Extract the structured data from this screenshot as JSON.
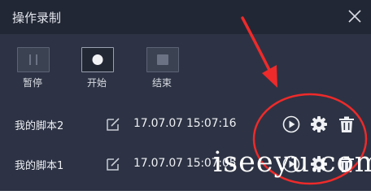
{
  "window": {
    "title": "操作录制",
    "close_icon": "close-icon"
  },
  "controls": [
    {
      "label": "暂停",
      "icon": "pause-icon"
    },
    {
      "label": "开始",
      "icon": "record-icon"
    },
    {
      "label": "结束",
      "icon": "stop-icon"
    }
  ],
  "scripts": [
    {
      "name": "我的脚本2",
      "time": "17.07.07 15:07:16"
    },
    {
      "name": "我的脚本1",
      "time": "17.07.07 15:07:05"
    }
  ],
  "row_actions": [
    "play-icon",
    "gear-icon",
    "trash-icon"
  ],
  "annotation_color": "#ee2a2a",
  "watermark": "iseeyu.com"
}
